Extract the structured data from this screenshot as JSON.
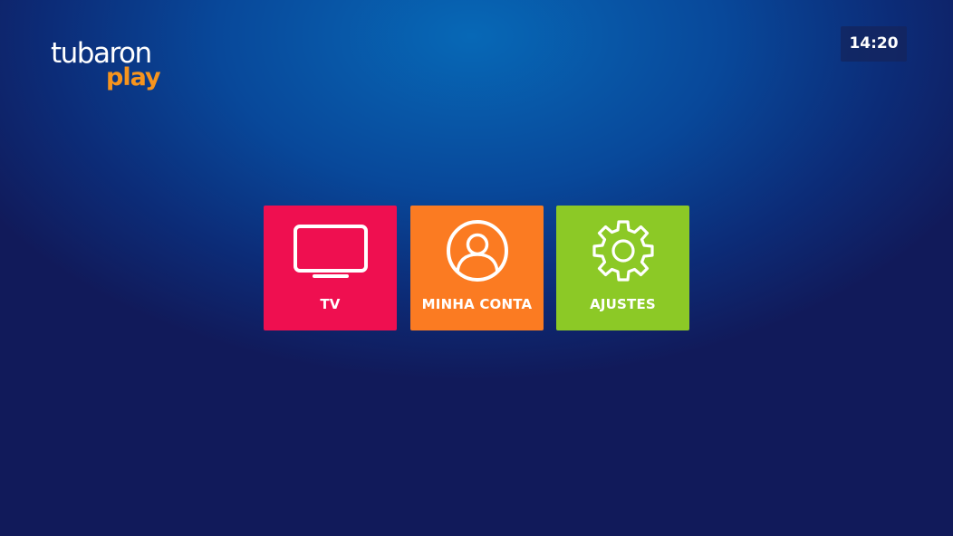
{
  "brand": {
    "logo_word_1": "tubaron",
    "logo_word_2": "play",
    "logo_color_1": "#ffffff",
    "logo_color_2": "#f7941d"
  },
  "clock": {
    "time": "14:20"
  },
  "menu": {
    "tiles": [
      {
        "label": "TV",
        "icon": "tv-icon",
        "color": "#ef0f50"
      },
      {
        "label": "MINHA CONTA",
        "icon": "user-account-icon",
        "color": "#fb7b22"
      },
      {
        "label": "AJUSTES",
        "icon": "gear-icon",
        "color": "#8cc926"
      }
    ]
  }
}
